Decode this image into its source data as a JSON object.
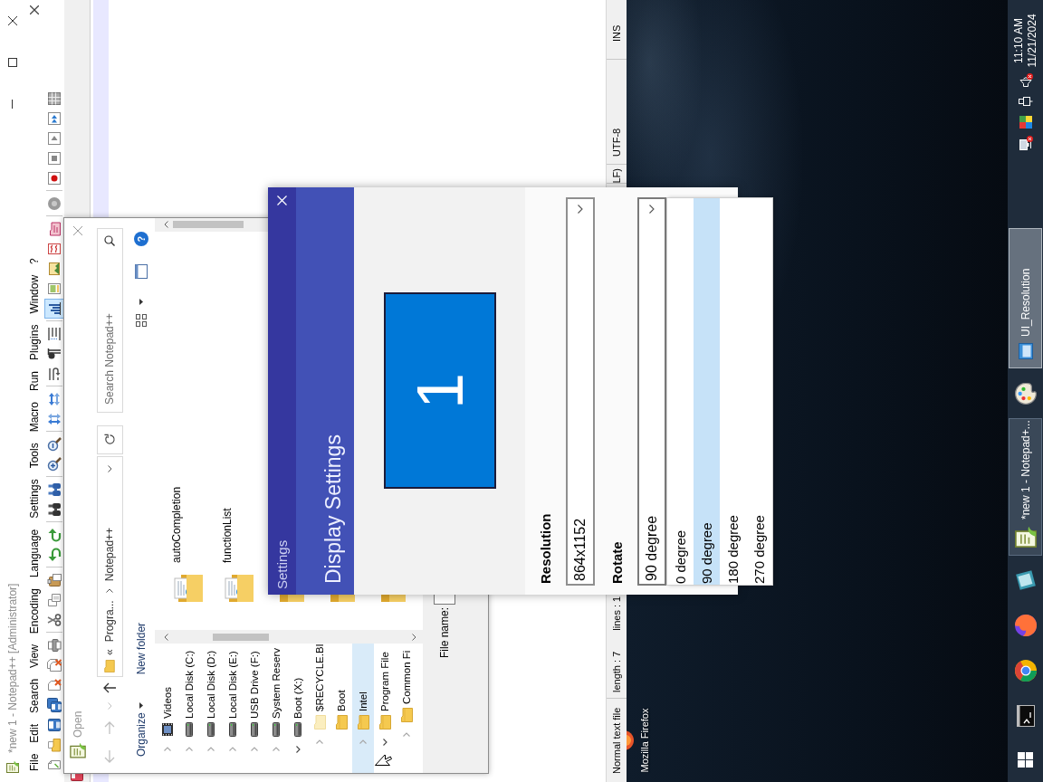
{
  "notepad": {
    "title": "*new 1 - Notepad++ [Administrator]",
    "menu": [
      "File",
      "Edit",
      "Search",
      "View",
      "Encoding",
      "Language",
      "Settings",
      "Tools",
      "Macro",
      "Run",
      "Plugins",
      "Window",
      "?"
    ],
    "toolbar": [
      {
        "buttons": [
          {
            "kind": "new",
            "pressed": false
          },
          {
            "kind": "open",
            "pressed": false
          },
          {
            "kind": "save",
            "pressed": false
          },
          {
            "kind": "saveall",
            "pressed": false
          },
          {
            "kind": "close",
            "pressed": false
          },
          {
            "kind": "closeall",
            "pressed": false
          },
          {
            "kind": "print",
            "pressed": false
          }
        ]
      },
      {
        "buttons": [
          {
            "kind": "cut",
            "pressed": false
          },
          {
            "kind": "copy",
            "pressed": false
          },
          {
            "kind": "paste",
            "pressed": false
          }
        ]
      },
      {
        "buttons": [
          {
            "kind": "undo",
            "pressed": false
          },
          {
            "kind": "redo",
            "pressed": false
          }
        ]
      },
      {
        "buttons": [
          {
            "kind": "find",
            "pressed": false
          },
          {
            "kind": "replace",
            "pressed": false
          }
        ]
      },
      {
        "buttons": [
          {
            "kind": "zoomin",
            "pressed": false
          },
          {
            "kind": "zoomout",
            "pressed": false
          }
        ]
      },
      {
        "buttons": [
          {
            "kind": "syncv",
            "pressed": false
          },
          {
            "kind": "synch",
            "pressed": false
          }
        ]
      },
      {
        "buttons": [
          {
            "kind": "wrap",
            "pressed": false
          },
          {
            "kind": "allchars",
            "pressed": false
          },
          {
            "kind": "indent",
            "pressed": false
          }
        ]
      },
      {
        "buttons": [
          {
            "kind": "chart",
            "pressed": true
          },
          {
            "kind": "docmap",
            "pressed": false
          },
          {
            "kind": "picture",
            "pressed": false
          },
          {
            "kind": "funclist",
            "pressed": false
          },
          {
            "kind": "workspace",
            "pressed": false
          }
        ]
      },
      {
        "buttons": [
          {
            "kind": "monitor",
            "pressed": false
          }
        ]
      },
      {
        "buttons": [
          {
            "kind": "record",
            "pressed": false
          },
          {
            "kind": "stop",
            "pressed": false
          },
          {
            "kind": "play",
            "pressed": false
          },
          {
            "kind": "playmulti",
            "pressed": false
          },
          {
            "kind": "savemacro",
            "pressed": false
          }
        ]
      }
    ],
    "status_bar": {
      "file_type": "Normal text file",
      "length": "length : 7",
      "lines": "lines : 1",
      "eol": "LF)",
      "encoding": "UTF-8",
      "mode": "INS"
    }
  },
  "open_dialog": {
    "title": "Open",
    "nav_buttons": [
      {
        "kind": "back",
        "disabled": true
      },
      {
        "kind": "forward",
        "disabled": true
      },
      {
        "kind": "recent",
        "disabled": true
      },
      {
        "kind": "up",
        "disabled": false
      }
    ],
    "address": {
      "overflow": "«",
      "crumbs": [
        "Progra...",
        "Notepad++"
      ]
    },
    "search": {
      "placeholder": "Search Notepad++"
    },
    "commands": [
      {
        "label": "Organize",
        "dropdown": true
      },
      {
        "label": "New folder",
        "dropdown": false
      }
    ],
    "help": "?",
    "nav_pane": [
      {
        "label": "Videos",
        "kind": "videos",
        "expanded": false,
        "selected": false
      },
      {
        "label": "Local Disk (C:)",
        "kind": "drive",
        "expanded": false,
        "selected": false
      },
      {
        "label": "Local Disk (D:)",
        "kind": "drive",
        "expanded": false,
        "selected": false
      },
      {
        "label": "Local Disk (E:)",
        "kind": "drive",
        "expanded": false,
        "selected": false
      },
      {
        "label": "USB Drive (F:)",
        "kind": "drive",
        "expanded": false,
        "selected": false
      },
      {
        "label": "System Reserv",
        "kind": "drive",
        "expanded": false,
        "selected": false
      },
      {
        "label": "Boot (X:)",
        "kind": "drive",
        "expanded": true,
        "selected": false,
        "children": [
          {
            "label": "$RECYCLE.BI",
            "kind": "hiddenfolder",
            "expanded": false,
            "selected": false
          },
          {
            "label": "Boot",
            "kind": "folder",
            "selected": false
          },
          {
            "label": "Intel",
            "kind": "folder",
            "expanded": false,
            "selected": true
          },
          {
            "label": "Program File",
            "kind": "folder",
            "expanded": true,
            "selected": false,
            "children": [
              {
                "label": "Common Fi",
                "kind": "folder",
                "expanded": false,
                "selected": false
              }
            ]
          }
        ]
      }
    ],
    "files": [
      {
        "name": "autoCompletion"
      },
      {
        "name": "functionList"
      }
    ],
    "file_name_label": "File name:"
  },
  "display_settings": {
    "title": "Settings",
    "heading": "Display Settings",
    "monitor": "1",
    "fields": [
      {
        "label": "Resolution",
        "value": "864x1152",
        "expanded": false
      },
      {
        "label": "Rotate",
        "value": "90 degree",
        "expanded": true,
        "options": [
          {
            "label": "0 degree",
            "selected": false
          },
          {
            "label": "90 degree",
            "selected": true
          },
          {
            "label": "180 degree",
            "selected": false
          },
          {
            "label": "270 degree",
            "selected": false
          }
        ]
      }
    ]
  },
  "desktop": {
    "shortcuts": [
      {
        "label": "Mozilla Firefox"
      }
    ]
  },
  "taskbar": {
    "items": [
      {
        "kind": "terminal",
        "open": false,
        "selected": false
      },
      {
        "kind": "browser",
        "open": false,
        "selected": false
      },
      {
        "kind": "globe",
        "open": false,
        "selected": false
      },
      {
        "kind": "notebook",
        "open": false,
        "selected": false
      },
      {
        "kind": "notepad",
        "open": true,
        "selected": false,
        "label": "*new 1 - Notepad+..."
      },
      {
        "kind": "palette",
        "open": false,
        "selected": false
      },
      {
        "kind": "window",
        "open": true,
        "selected": true,
        "label": "UI_Resolution"
      }
    ],
    "tray": [
      {
        "kind": "network",
        "alert": true
      },
      {
        "kind": "colors",
        "alert": false
      },
      {
        "kind": "plug",
        "alert": false
      },
      {
        "kind": "speaker",
        "alert": true
      }
    ],
    "clock": {
      "time": "11:10 AM",
      "date": "11/21/2024"
    }
  }
}
